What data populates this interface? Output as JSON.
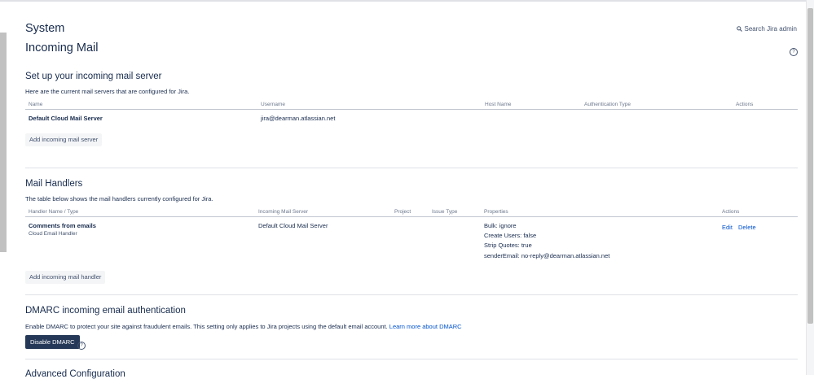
{
  "header": {
    "system_title": "System",
    "page_title": "Incoming Mail",
    "search_label": "Search Jira admin"
  },
  "mail_servers": {
    "heading": "Set up your incoming mail server",
    "description": "Here are the current mail servers that are configured for Jira.",
    "columns": {
      "name": "Name",
      "username": "Username",
      "host_name": "Host Name",
      "auth_type": "Authentication Type",
      "actions": "Actions"
    },
    "rows": [
      {
        "name": "Default Cloud Mail Server",
        "username": "jira@dearman.atlassian.net",
        "host_name": "",
        "auth_type": ""
      }
    ],
    "add_button": "Add incoming mail server"
  },
  "mail_handlers": {
    "heading": "Mail Handlers",
    "description": "The table below shows the mail handlers currently configured for Jira.",
    "columns": {
      "handler": "Handler Name / Type",
      "server": "Incoming Mail Server",
      "project": "Project",
      "issue_type": "Issue Type",
      "properties": "Properties",
      "actions": "Actions"
    },
    "rows": [
      {
        "name": "Comments from emails",
        "type": "Cloud Email Handler",
        "server": "Default Cloud Mail Server",
        "properties": [
          "Bulk: ignore",
          "Create Users: false",
          "Strip Quotes: true",
          "senderEmail: no-reply@dearman.atlassian.net"
        ],
        "edit": "Edit",
        "delete": "Delete"
      }
    ],
    "add_button": "Add incoming mail handler"
  },
  "dmarc": {
    "heading": "DMARC incoming email authentication",
    "description": "Enable DMARC to protect your site against fraudulent emails. This setting only applies to Jira projects using the default email account.",
    "learn_more": "Learn more about DMARC",
    "disable_button": "Disable DMARC"
  },
  "advanced": {
    "heading": "Advanced Configuration"
  },
  "colors": {
    "link": "#0052cc",
    "primary_button": "#253858",
    "text": "#172b4d"
  }
}
